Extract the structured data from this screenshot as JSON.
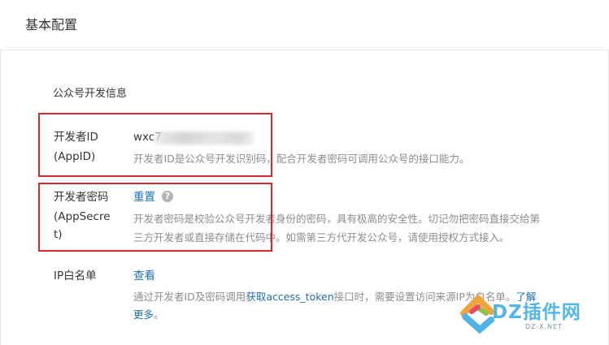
{
  "header": {
    "title": "基本配置"
  },
  "section": {
    "title": "公众号开发信息"
  },
  "app_id": {
    "label_line1": "开发者ID",
    "label_line2": "(AppID)",
    "value_visible_prefix": "wxc7",
    "description": "开发者ID是公众号开发识别码，配合开发者密码可调用公众号的接口能力。"
  },
  "app_secret": {
    "label_line1": "开发者密码",
    "label_line2": "(AppSecre",
    "label_line3": "t)",
    "reset_link": "重置",
    "help_icon": "?",
    "description_line1": "开发者密码是校验公众号开发者身份的密码，具有极高的安全性。切记勿把密码直接交给第",
    "description_line2": "三方开发者或直接存储在代码中。如需第三方代开发公众号，请使用授权方式接入。"
  },
  "ip_whitelist": {
    "label": "IP白名单",
    "view_link": "查看",
    "desc_part1": "通过开发者ID及密码调用",
    "desc_link": "获取access_token",
    "desc_part2": "接口时，需要设置访问来源IP为白名单。",
    "learn_more_1": "了解",
    "learn_more_2": "更多",
    "desc_end": "。"
  },
  "watermark": {
    "text": "DZ插件网",
    "sub": "DZ-X.NET"
  },
  "colors": {
    "link": "#1f6fb5",
    "highlight_box": "#d9282f",
    "muted_text": "#8d8d8d",
    "divider": "#e7e7eb"
  }
}
